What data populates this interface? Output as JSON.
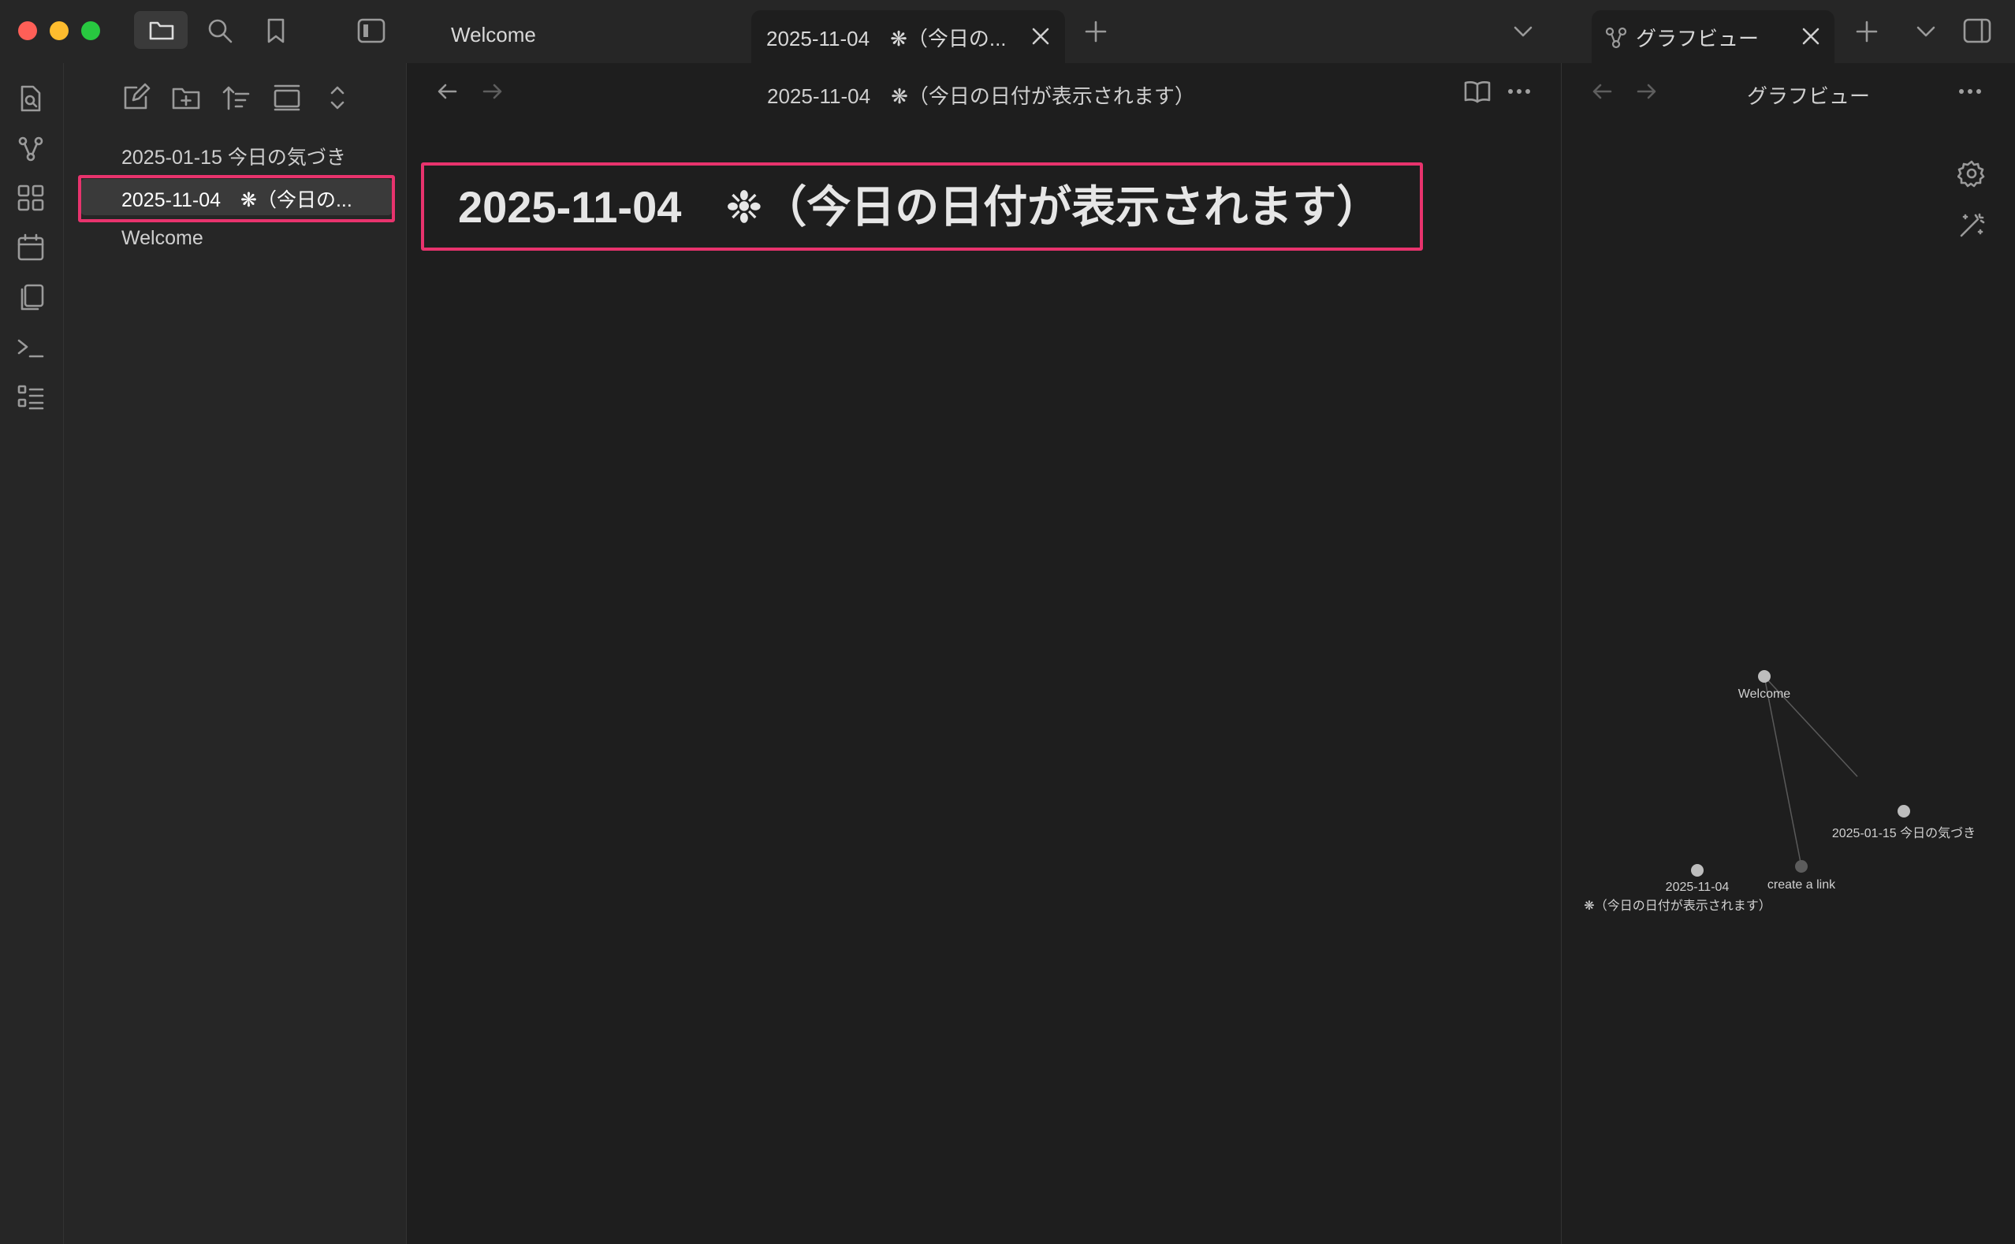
{
  "tabs": {
    "welcome": "Welcome",
    "active_note": "2025-11-04　❋（今日の...",
    "graph": "グラフビュー"
  },
  "explorer": {
    "files": [
      "2025-01-15 今日の気づき",
      "2025-11-04　❋（今日の...",
      "Welcome"
    ]
  },
  "editor": {
    "header_title": "2025-11-04　❋（今日の日付が表示されます）",
    "note_title": "2025-11-04　❉（今日の日付が表示されます）"
  },
  "graph_view": {
    "header_title": "グラフビュー",
    "nodes": {
      "welcome": "Welcome",
      "note_0115": "2025-01-15 今日の気づき",
      "create_link": "create a link",
      "note_1104_line1": "2025-11-04",
      "note_1104_line2": "❋（今日の日付が表示されます）"
    }
  },
  "colors": {
    "highlight": "#e8336d",
    "close_dot": "#ff5f57",
    "minimize_dot": "#febc2e",
    "zoom_dot": "#28c840"
  }
}
